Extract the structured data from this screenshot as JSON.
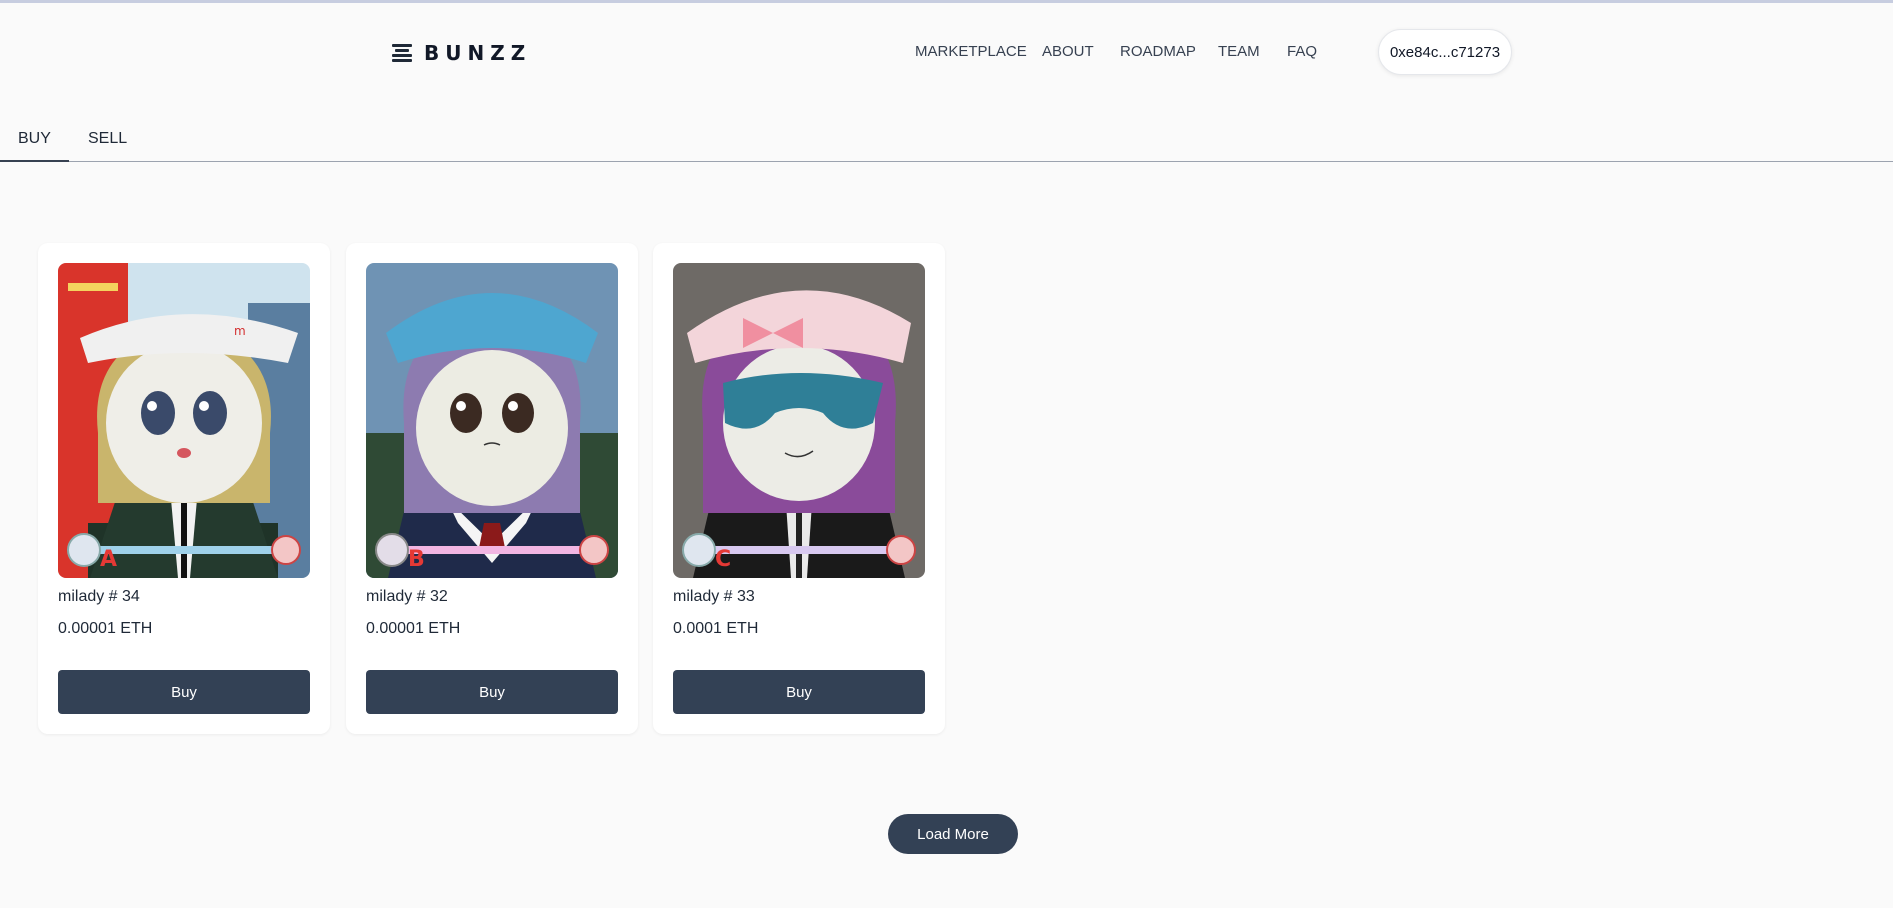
{
  "header": {
    "logo_text": "BUNZZ",
    "nav": [
      "MARKETPLACE",
      "ABOUT",
      "ROADMAP",
      "TEAM",
      "FAQ"
    ],
    "wallet_address": "0xe84c...c71273"
  },
  "tabs": {
    "buy": "BUY",
    "sell": "SELL",
    "active": "BUY"
  },
  "listings": [
    {
      "name": "milady # 34",
      "price": "0.00001 ETH",
      "buy_label": "Buy",
      "rank": "A"
    },
    {
      "name": "milady # 32",
      "price": "0.00001 ETH",
      "buy_label": "Buy",
      "rank": "B"
    },
    {
      "name": "milady # 33",
      "price": "0.0001 ETH",
      "buy_label": "Buy",
      "rank": "C"
    }
  ],
  "load_more_label": "Load More",
  "colors": {
    "button": "#334155",
    "background": "#fafafa",
    "card": "#ffffff"
  }
}
